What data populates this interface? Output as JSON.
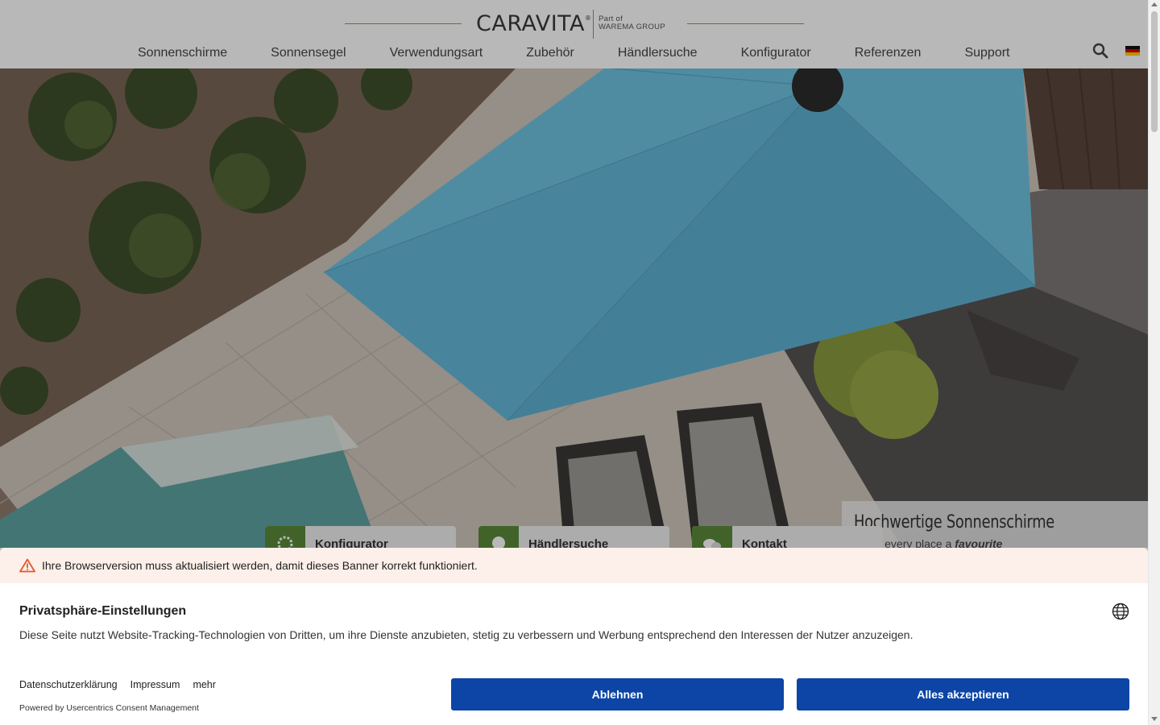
{
  "header": {
    "logo": {
      "brand": "CARAVITA",
      "registered": "®",
      "sub_line1": "Part of",
      "sub_line2": "WAREMA GROUP"
    },
    "nav": [
      "Sonnenschirme",
      "Sonnensegel",
      "Verwendungsart",
      "Zubehör",
      "Händlersuche",
      "Konfigurator",
      "Referenzen",
      "Support"
    ],
    "icons": {
      "search": "search-icon",
      "language": "german-flag-icon"
    }
  },
  "hero": {
    "title": "Hochwertige Sonnenschirme",
    "subtitle_prefix": "Make every place a ",
    "subtitle_emphasis": "favourite",
    "quick_links": [
      {
        "label": "Konfigurator",
        "icon": "gear-icon"
      },
      {
        "label": "Händlersuche",
        "icon": "location-pin-icon"
      },
      {
        "label": "Kontakt",
        "icon": "chat-icon"
      }
    ]
  },
  "consent": {
    "warning": "Ihre Browserversion muss aktualisiert werden, damit dieses Banner korrekt funktioniert.",
    "title": "Privatsphäre-Einstellungen",
    "description": "Diese Seite nutzt Website-Tracking-Technologien von Dritten, um ihre Dienste anzubieten, stetig zu verbessern und Werbung entsprechend den Interessen der Nutzer anzuzeigen.",
    "links": [
      "Datenschutzerklärung",
      "Impressum",
      "mehr"
    ],
    "powered_by": "Powered by Usercentrics Consent Management",
    "deny_label": "Ablehnen",
    "accept_label": "Alles akzeptieren"
  },
  "colors": {
    "accent_green": "#6aa84f",
    "button_blue": "#0c45a5",
    "warning_bg": "#fdefe9",
    "umbrella_blue": "#6fc3e0"
  }
}
